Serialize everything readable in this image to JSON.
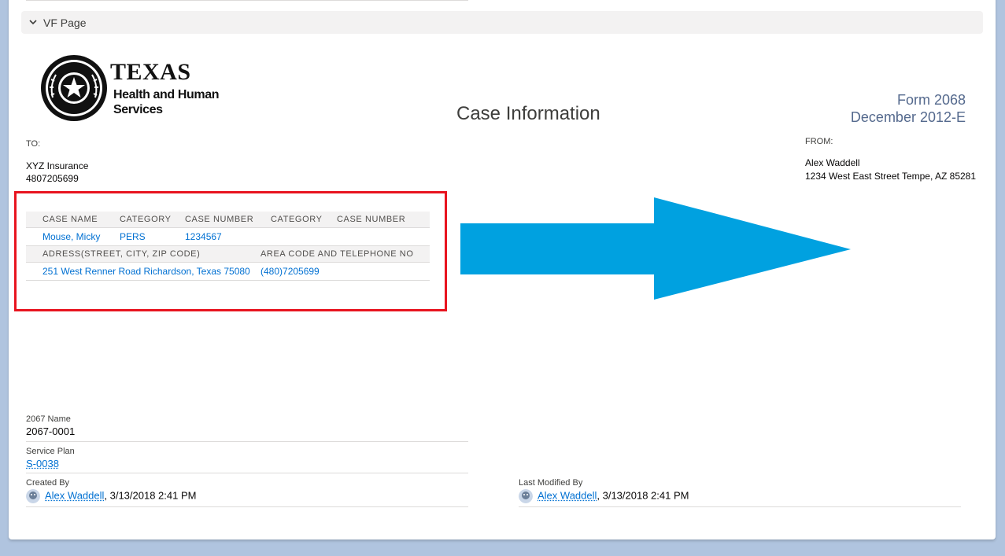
{
  "section": {
    "title": "VF Page"
  },
  "logo": {
    "line1": "TEXAS",
    "line2": "Health and Human Services"
  },
  "document": {
    "title": "Case Information",
    "form_number": "Form 2068",
    "form_date": "December 2012-E"
  },
  "to": {
    "label": "TO:",
    "name": "XYZ Insurance",
    "phone": "4807205699"
  },
  "from": {
    "label": "FROM:",
    "name": "Alex Waddell",
    "address": "1234 West East Street Tempe, AZ 85281"
  },
  "case_table": {
    "headers": [
      "CASE NAME",
      "CATEGORY",
      "CASE NUMBER",
      "CATEGORY",
      "CASE NUMBER"
    ],
    "row1": {
      "case_name": "Mouse, Micky",
      "category": "PERS",
      "case_number": "1234567"
    },
    "headers2": [
      "ADRESS(STREET, CITY, ZIP CODE)",
      "AREA CODE AND TELEPHONE NO"
    ],
    "row2": {
      "address": "251 West Renner Road Richardson, Texas 75080",
      "phone": "(480)7205699"
    }
  },
  "fields": {
    "name_label": "2067 Name",
    "name_value": "2067-0001",
    "service_plan_label": "Service Plan",
    "service_plan_value": "S-0038",
    "created_by_label": "Created By",
    "created_by_user": "Alex Waddell",
    "created_by_date": ", 3/13/2018 2:41 PM",
    "modified_by_label": "Last Modified By",
    "modified_by_user": "Alex Waddell",
    "modified_by_date": ", 3/13/2018 2:41 PM"
  },
  "colors": {
    "highlight": "#e8141f",
    "arrow": "#00a1e0",
    "link": "#0070d2"
  },
  "icons": {
    "chevron": "chevron-down-icon",
    "arrow": "right-arrow-icon",
    "avatar": "user-avatar-icon"
  }
}
